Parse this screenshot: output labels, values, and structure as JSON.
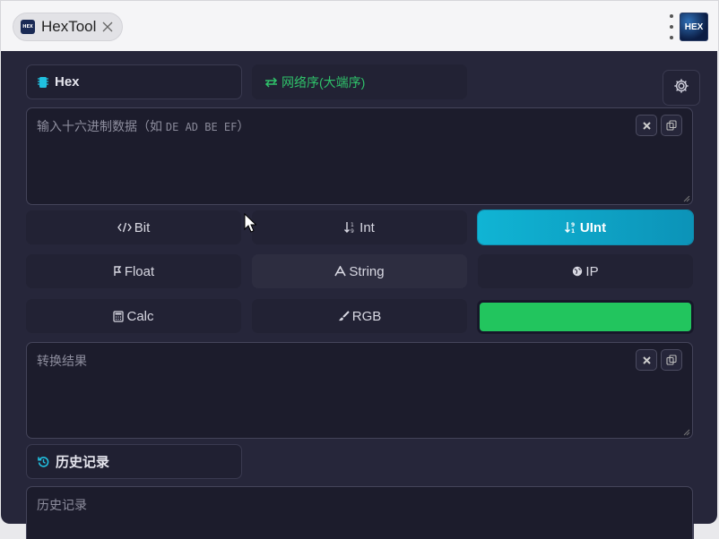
{
  "tab": {
    "icon_text": "HEX",
    "title": "HexTool"
  },
  "app_logo": {
    "text": "HEX"
  },
  "hex_section": {
    "label": "Hex"
  },
  "endian": {
    "label": "网络序(大端序)"
  },
  "input": {
    "placeholder_text": "输入十六进制数据（如 ",
    "placeholder_example": "DE AD BE EF",
    "placeholder_end": "）"
  },
  "types": [
    {
      "label": "Bit",
      "icon": "code-icon"
    },
    {
      "label": "Int",
      "icon": "sort-numeric-icon"
    },
    {
      "label": "UInt",
      "icon": "sort-numeric-up-icon",
      "active": true
    },
    {
      "label": "Float",
      "icon": "float-icon"
    },
    {
      "label": "String",
      "icon": "font-icon"
    },
    {
      "label": "IP",
      "icon": "globe-icon"
    },
    {
      "label": "Calc",
      "icon": "calculator-icon"
    },
    {
      "label": "RGB",
      "icon": "brush-icon"
    }
  ],
  "rgb_preview": {
    "color": "#22c55e"
  },
  "result": {
    "placeholder": "转换结果"
  },
  "history": {
    "label": "历史记录",
    "placeholder": "历史记录"
  },
  "colors": {
    "accent": "#10b4d4",
    "endian_green": "#2fc26a",
    "panel_bg": "#26263a"
  }
}
